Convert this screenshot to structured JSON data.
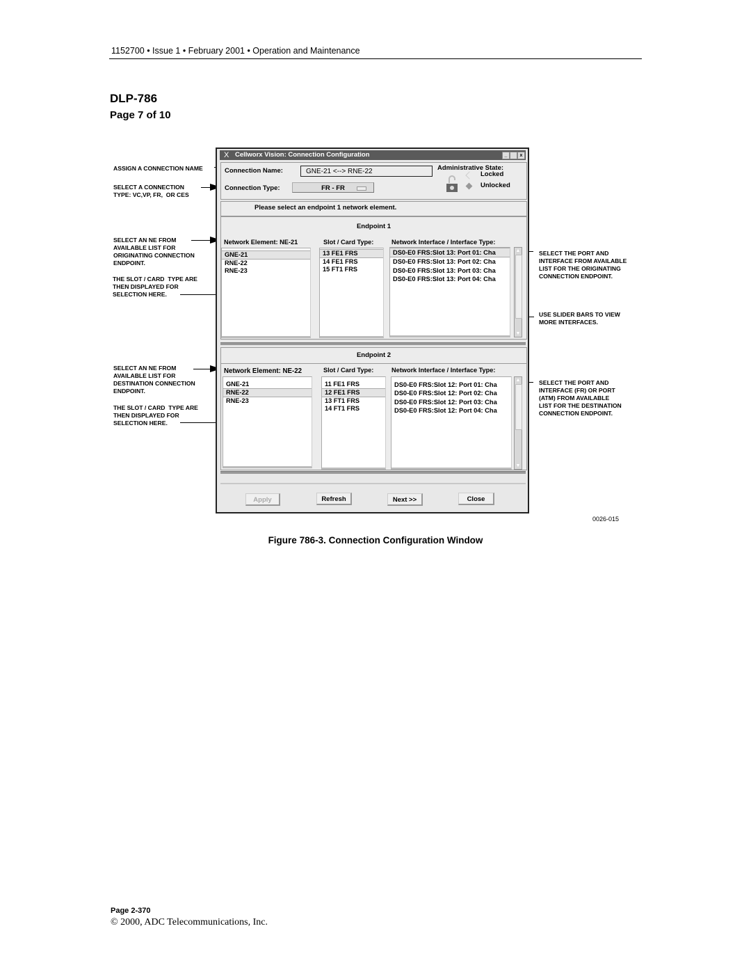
{
  "page_header": "1152700 • Issue 1 • February 2001 • Operation and Maintenance",
  "dlp_title": "DLP-786",
  "page_of": "Page 7 of 10",
  "annotations": {
    "assign_name": "ASSIGN A CONNECTION NAME",
    "select_type": "SELECT A CONNECTION\nTYPE: VC,VP, FR,  OR CES",
    "select_ne_orig": "SELECT AN NE FROM\nAVAILABLE LIST FOR\nORIGINATING CONNECTION\nENDPOINT.",
    "slot_card_1": "THE SLOT / CARD  TYPE ARE\nTHEN DISPLAYED FOR\nSELECTION HERE.",
    "select_ne_dest": "SELECT AN NE FROM\nAVAILABLE LIST FOR\nDESTINATION CONNECTION\nENDPOINT.",
    "slot_card_2": "THE SLOT / CARD  TYPE ARE\nTHEN DISPLAYED FOR\nSELECTION HERE.",
    "select_port_orig": "SELECT THE PORT AND\nINTERFACE FROM AVAILABLE\nLIST FOR THE ORIGINATING\nCONNECTION ENDPOINT.",
    "slider_bars": "USE SLIDER BARS TO VIEW\nMORE INTERFACES.",
    "select_port_dest": "SELECT THE PORT AND\nINTERFACE (FR) OR PORT\n(ATM) FROM AVAILABLE\nLIST FOR THE DESTINATION\nCONNECTION ENDPOINT."
  },
  "window": {
    "title_glyph": "X",
    "title": "Cellworx Vision: Connection Configuration",
    "controls": {
      "minimize": "_",
      "maximize": "",
      "close": "x"
    },
    "connection_name_label": "Connection Name:",
    "connection_name_value": "GNE-21 <--> RNE-22",
    "connection_type_label": "Connection Type:",
    "connection_type_value": "FR - FR",
    "admin_state_label": "Administrative State:",
    "admin_state_options": [
      "Locked",
      "Unlocked"
    ],
    "admin_state_selected": "Unlocked",
    "prompt": "Please select an endpoint 1 network element.",
    "endpoint1": {
      "title": "Endpoint 1",
      "ne_label": "Network Element:  NE-21",
      "slot_label": "Slot / Card Type:",
      "iface_label": "Network Interface / Interface Type:",
      "network_elements": [
        "GNE-21",
        "RNE-22",
        "RNE-23"
      ],
      "ne_selected": "GNE-21",
      "slots": [
        "13 FE1 FRS",
        "14 FE1 FRS",
        "15 FT1 FRS"
      ],
      "slot_selected": "13 FE1 FRS",
      "interfaces": [
        "DS0-E0 FRS:Slot 13: Port 01: Cha",
        "DS0-E0 FRS:Slot 13: Port 02: Cha",
        "DS0-E0 FRS:Slot 13: Port 03: Cha",
        "DS0-E0 FRS:Slot 13: Port 04: Cha"
      ],
      "iface_selected": "DS0-E0 FRS:Slot 13: Port 01: Cha"
    },
    "endpoint2": {
      "title": "Endpoint 2",
      "ne_label": "Network Element:  NE-22",
      "slot_label": "Slot / Card Type:",
      "iface_label": "Network Interface / Interface Type:",
      "network_elements": [
        "GNE-21",
        "RNE-22",
        "RNE-23"
      ],
      "ne_selected": "RNE-22",
      "slots": [
        "11 FE1 FRS",
        "12 FE1 FRS",
        "13 FT1 FRS",
        "14 FT1 FRS"
      ],
      "slot_selected": "12 FE1 FRS",
      "interfaces": [
        "DS0-E0 FRS:Slot 12: Port 01: Cha",
        "DS0-E0 FRS:Slot 12: Port 02: Cha",
        "DS0-E0 FRS:Slot 12: Port 03: Cha",
        "DS0-E0 FRS:Slot 12: Port 04: Cha"
      ],
      "iface_selected": ""
    },
    "buttons": {
      "apply": "Apply",
      "refresh": "Refresh",
      "next": "Next >>",
      "close": "Close"
    },
    "apply_enabled": false
  },
  "figure_id": "0026-015",
  "caption": "Figure 786-3. Connection Configuration Window",
  "footer_page": "Page 2-370",
  "copyright": "© 2000, ADC Telecommunications, Inc."
}
